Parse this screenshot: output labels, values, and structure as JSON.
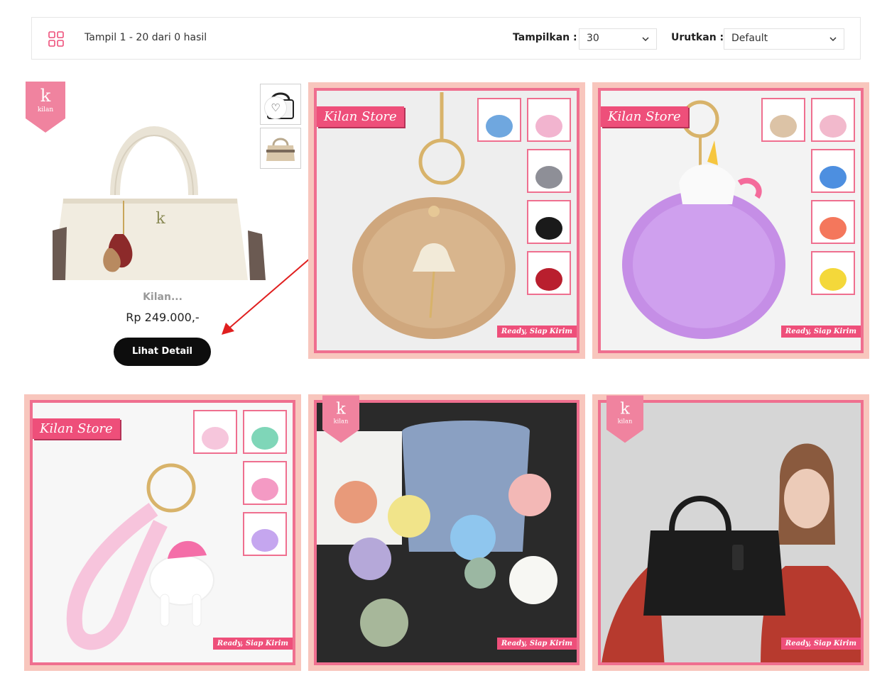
{
  "toolbar": {
    "grid_icon": "grid-view-icon",
    "results_text": "Tampil 1 - 20 dari 0 hasil",
    "show_label": "Tampilkan :",
    "show_value": "30",
    "sort_label": "Urutkan :",
    "sort_value": "Default"
  },
  "featured_product": {
    "name": "Kilan...",
    "price": "Rp 249.000,-",
    "button_label": "Lihat Detail",
    "wishlist_icon": "heart-icon"
  },
  "badges": {
    "store": "Kilan Store",
    "ready": "Ready, Siap Kirim",
    "brand": "kilan"
  },
  "products": [
    {
      "name": "ballerina-pompom-keychain",
      "main_color": "#cfa77d",
      "thumb_colors": [
        "#6fa7df",
        "#f2b4cf",
        "#8e8f97",
        "#1a1a1a",
        "#b91f2e"
      ]
    },
    {
      "name": "unicorn-pompom-keychain",
      "main_color": "#c58ee6",
      "thumb_colors": [
        "#dcc3a6",
        "#f2b9cc",
        "#4d8fe0",
        "#f4775c",
        "#f4d83a"
      ]
    },
    {
      "name": "unicorn-strap-keychain",
      "main_color": "#f7c4dc",
      "thumb_colors": [
        "#f6c6dc",
        "#7fd6b8",
        "#f49ac4",
        "#c5a6ef"
      ]
    },
    {
      "name": "flower-pompom-charms",
      "main_color": "#8aa0c2",
      "thumb_colors": []
    },
    {
      "name": "black-leather-handbag",
      "main_color": "#1c1c1c",
      "thumb_colors": []
    }
  ],
  "colors": {
    "accent_pink": "#ee4f7a",
    "frame_pink": "#f8c6bd",
    "arrow_red": "#e01f1f"
  }
}
